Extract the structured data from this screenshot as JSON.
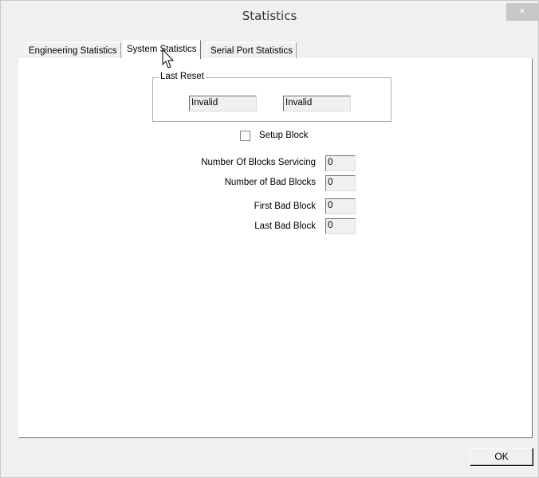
{
  "window": {
    "title": "Statistics",
    "close_glyph": "×"
  },
  "tabs": [
    {
      "label": "Engineering Statistics",
      "active": false
    },
    {
      "label": "System Statistics",
      "active": true
    },
    {
      "label": "Serial Port Statistics",
      "active": false
    }
  ],
  "last_reset": {
    "label": "Last Reset",
    "value1": "Invalid",
    "value2": "Invalid"
  },
  "setup_block": {
    "label": "Setup Block",
    "checked": false
  },
  "stats": [
    {
      "label": "Number Of Blocks Servicing",
      "value": "0"
    },
    {
      "label": "Number of Bad Blocks",
      "value": "0"
    },
    {
      "label": "First Bad Block",
      "value": "0"
    },
    {
      "label": "Last Bad Block",
      "value": "0"
    }
  ],
  "buttons": {
    "ok_label": "OK"
  },
  "icons": {
    "cursor": "mouse-pointer-icon",
    "close": "close-icon"
  }
}
